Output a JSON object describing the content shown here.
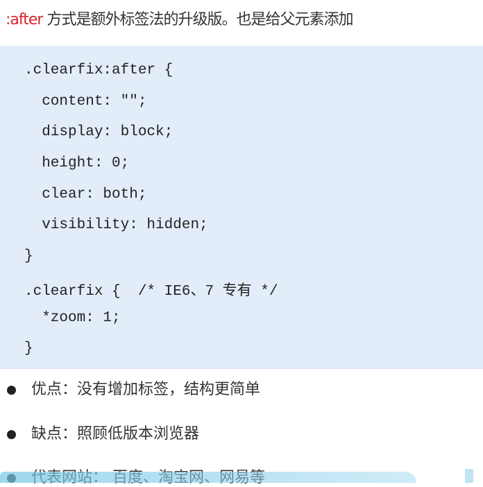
{
  "intro": {
    "keyword": ":after",
    "text": " 方式是额外标签法的升级版。也是给父元素添加"
  },
  "code_lines": [
    ".clearfix:after {",
    "  content: \"\";",
    "  display: block;",
    "  height: 0;",
    "  clear: both;",
    "  visibility: hidden;",
    "}",
    ".clearfix {  /* IE6、7 专有 */",
    "  *zoom: 1;",
    "}"
  ],
  "bullets": [
    "优点：没有增加标签，结构更简单",
    "缺点：照顾低版本浏览器",
    "代表网站： 百度、淘宝网、网易等"
  ]
}
